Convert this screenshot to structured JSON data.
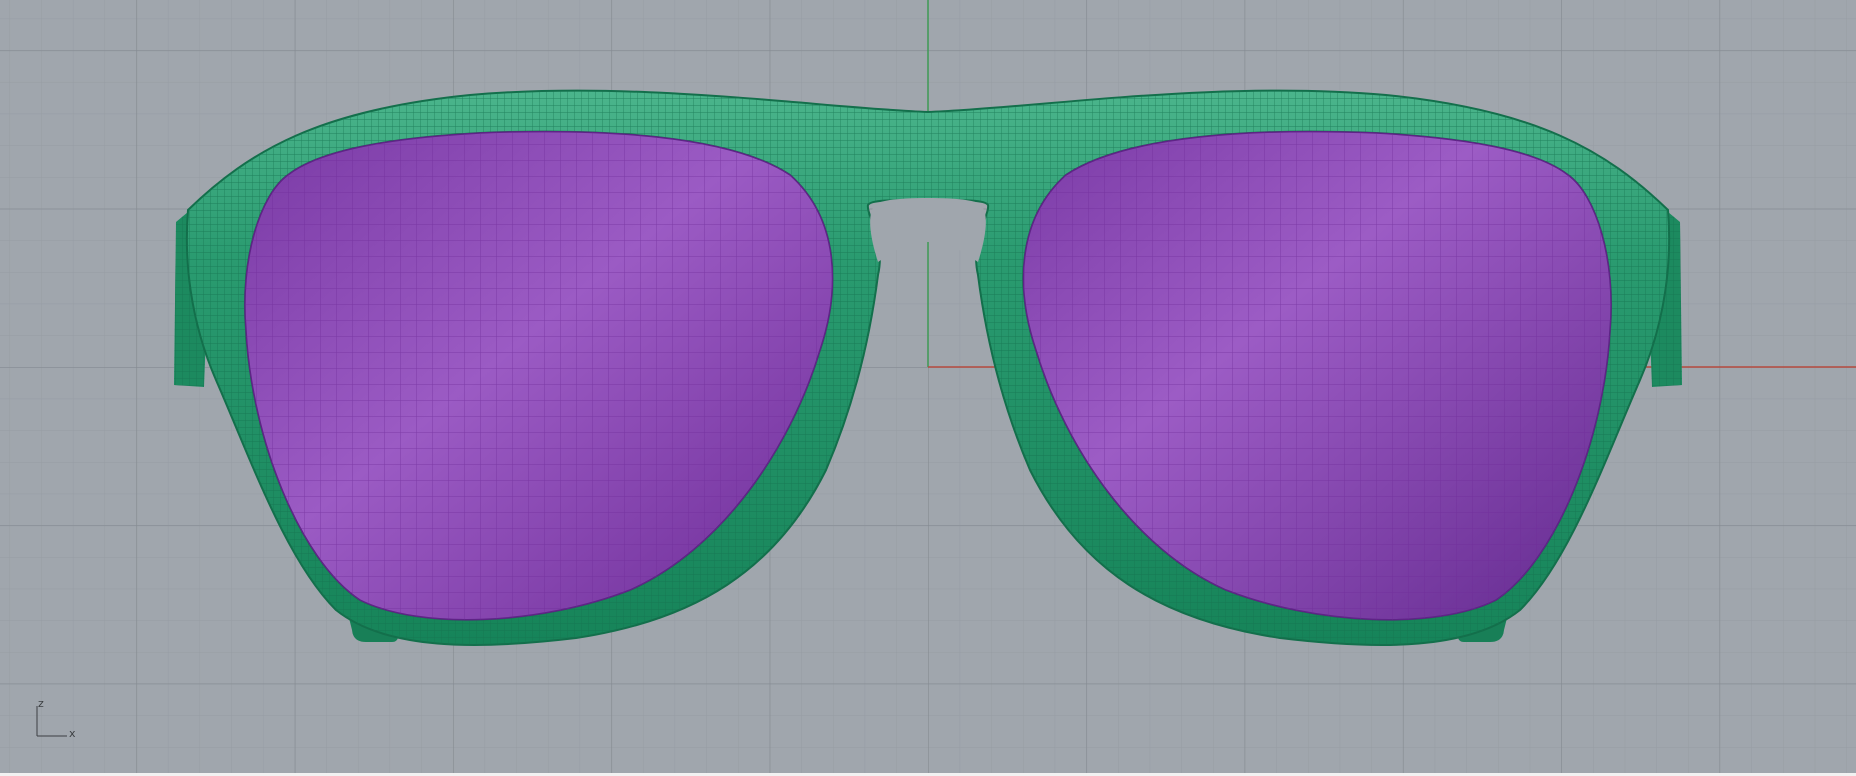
{
  "app": {
    "view": "Front"
  },
  "viewport": {
    "background": "#a0a6ad",
    "grid_minor_color": "#959ba2",
    "grid_major_color": "#868c93",
    "x_axis_color": "#b54a3f",
    "z_axis_color": "#3f9a55"
  },
  "model": {
    "object": "sunglasses",
    "frame_color": "#1f8f63",
    "lens_color": "#8a46b0",
    "display_mode": "mesh-wireframe"
  },
  "axis_indicator": {
    "vertical_label": "z",
    "horizontal_label": "x"
  }
}
